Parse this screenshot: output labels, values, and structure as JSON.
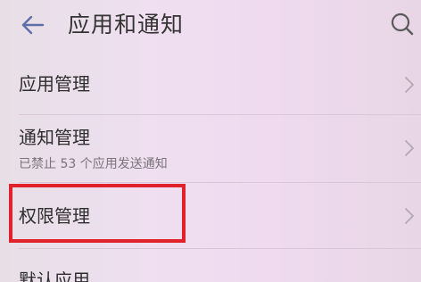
{
  "header": {
    "title": "应用和通知",
    "back_icon": "arrow-left-icon",
    "search_icon": "search-icon"
  },
  "items": [
    {
      "label": "应用管理"
    },
    {
      "label": "通知管理",
      "subtitle": "已禁止 53 个应用发送通知"
    },
    {
      "label": "权限管理"
    },
    {
      "label": "默认应用"
    }
  ],
  "colors": {
    "background": "#efdff0",
    "highlight": "#e1222b",
    "icon": "#5d6fa8"
  }
}
